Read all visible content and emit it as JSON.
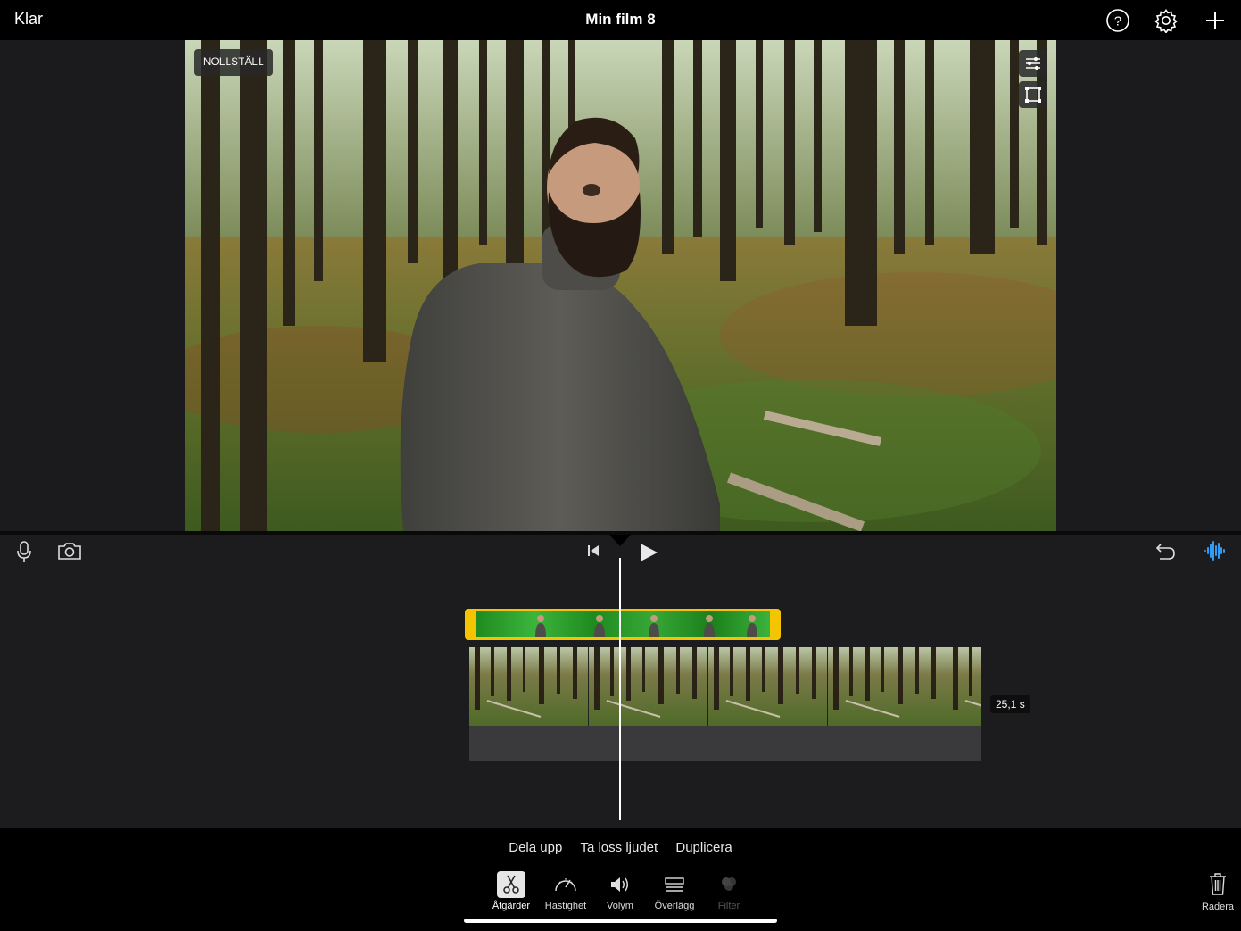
{
  "header": {
    "done_label": "Klar",
    "title": "Min film 8",
    "icons": [
      "help-icon",
      "settings-gear-icon",
      "add-icon"
    ]
  },
  "viewer": {
    "reset_label": "NOLLSTÄLL",
    "tools": [
      "adjust-sliders-icon",
      "crop-icon"
    ]
  },
  "timeline": {
    "left_tools": [
      "microphone-icon",
      "camera-icon"
    ],
    "playback": [
      "skip-to-start-icon",
      "play-icon"
    ],
    "right_tools": [
      "undo-icon",
      "audio-waveform-icon"
    ],
    "duration": "25,1 s",
    "colors": {
      "selection": "#f5c400",
      "waveform": "#2f9cf5"
    }
  },
  "actions": {
    "items": [
      "Dela upp",
      "Ta loss ljudet",
      "Duplicera"
    ]
  },
  "toolbar": {
    "items": [
      {
        "label": "Åtgärder",
        "icon": "scissors-icon",
        "active": true
      },
      {
        "label": "Hastighet",
        "icon": "speedometer-icon",
        "active": false
      },
      {
        "label": "Volym",
        "icon": "speaker-icon",
        "active": false
      },
      {
        "label": "Överlägg",
        "icon": "overlay-icon",
        "active": false
      },
      {
        "label": "Filter",
        "icon": "filter-icon",
        "disabled": true
      }
    ],
    "delete_label": "Radera"
  }
}
